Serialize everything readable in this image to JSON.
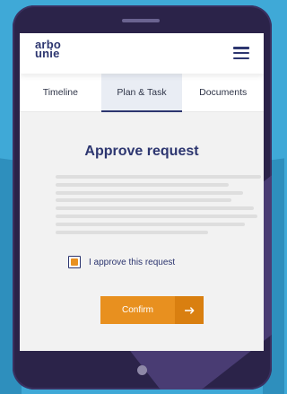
{
  "colors": {
    "background": "#3fa9d7",
    "device": "#2b2349",
    "brand": "#2d3670",
    "accent": "#e8901f",
    "content_bg": "#f2f2f2"
  },
  "header": {
    "logo_line1": "arbo",
    "logo_line2": "unie",
    "menu_icon": "hamburger-menu-icon"
  },
  "tabs": [
    {
      "label": "Timeline",
      "active": false
    },
    {
      "label": "Plan & Task",
      "active": true
    },
    {
      "label": "Documents",
      "active": false
    }
  ],
  "main": {
    "title": "Approve request",
    "placeholder_line_count": 8,
    "approve_label": "I approve this request",
    "approved": true,
    "confirm_label": "Confirm",
    "confirm_icon": "arrow-right-icon"
  }
}
